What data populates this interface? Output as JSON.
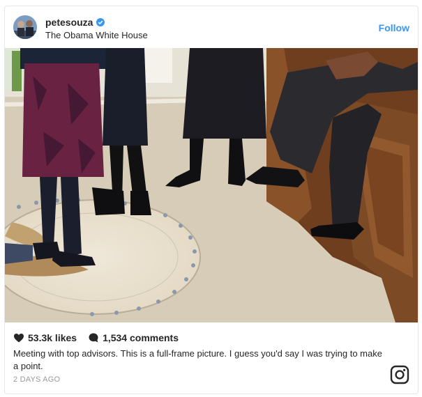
{
  "post": {
    "username": "petesouza",
    "location": "The Obama White House",
    "follow_label": "Follow",
    "likes": "53.3k likes",
    "comments": "1,534 comments",
    "caption": "Meeting with top advisors. This is a full-frame picture. I guess you'd say I was trying to make a point.",
    "time": "2 DAYS AGO"
  },
  "icons": {
    "verified": "verified-badge-icon",
    "like": "heart-icon",
    "comment": "comment-icon",
    "brand": "instagram-icon"
  },
  "colors": {
    "accent": "#3897f0",
    "text": "#262626",
    "muted": "#999999"
  }
}
